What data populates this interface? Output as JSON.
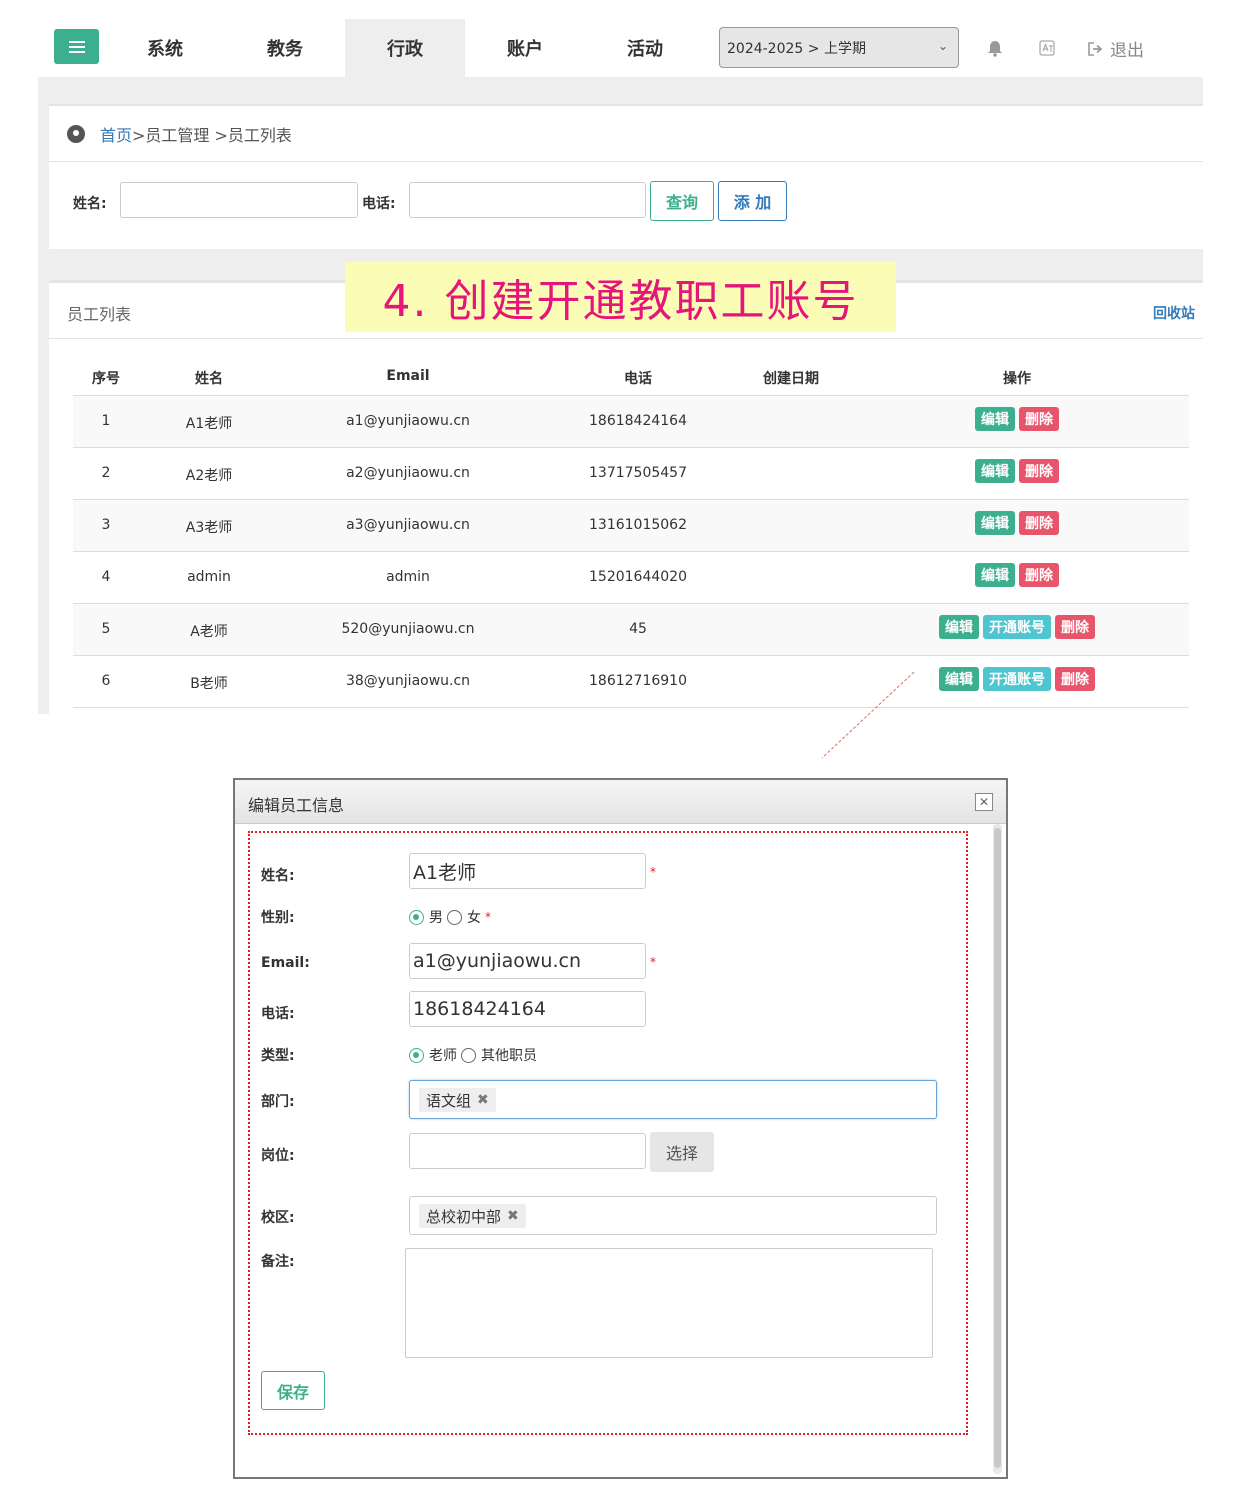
{
  "nav": {
    "tabs": [
      {
        "label": "系统",
        "active": false
      },
      {
        "label": "教务",
        "active": false
      },
      {
        "label": "行政",
        "active": true
      },
      {
        "label": "账户",
        "active": false
      },
      {
        "label": "活动",
        "active": false
      }
    ],
    "term_select": "2024-2025 > 上学期",
    "logout_label": "退出",
    "icons": [
      "menu-icon",
      "bell-icon",
      "translate-icon",
      "logout-icon"
    ],
    "accent_color": "#3cb08e"
  },
  "breadcrumb": {
    "home": "首页",
    "rest": ">员工管理 >员工列表"
  },
  "filters": {
    "name_label": "姓名:",
    "phone_label": "电话:",
    "query_label": "查询",
    "add_label": "添 加"
  },
  "list": {
    "title": "员工列表",
    "recycle_label": "回收站",
    "columns": [
      "序号",
      "姓名",
      "Email",
      "电话",
      "创建日期",
      "操作"
    ],
    "rows": [
      {
        "no": "1",
        "name": "A1老师",
        "email": "a1@yunjiaowu.cn",
        "phone": "18618424164",
        "created": "",
        "actions": [
          "编辑",
          "删除"
        ]
      },
      {
        "no": "2",
        "name": "A2老师",
        "email": "a2@yunjiaowu.cn",
        "phone": "13717505457",
        "created": "",
        "actions": [
          "编辑",
          "删除"
        ]
      },
      {
        "no": "3",
        "name": "A3老师",
        "email": "a3@yunjiaowu.cn",
        "phone": "13161015062",
        "created": "",
        "actions": [
          "编辑",
          "删除"
        ]
      },
      {
        "no": "4",
        "name": "admin",
        "email": "admin",
        "phone": "15201644020",
        "created": "",
        "actions": [
          "编辑",
          "删除"
        ]
      },
      {
        "no": "5",
        "name": "A老师",
        "email": "520@yunjiaowu.cn",
        "phone": "45",
        "created": "",
        "actions": [
          "编辑",
          "开通账号",
          "删除"
        ]
      },
      {
        "no": "6",
        "name": "B老师",
        "email": "38@yunjiaowu.cn",
        "phone": "18612716910",
        "created": "",
        "actions": [
          "编辑",
          "开通账号",
          "删除"
        ]
      }
    ]
  },
  "annotation": {
    "text": "4. 创建开通教职工账号",
    "bg_color": "#fbfcb6",
    "text_color": "#e5157a"
  },
  "dialog": {
    "title": "编辑员工信息",
    "fields": {
      "name_label": "姓名:",
      "name_value": "A1老师",
      "gender_label": "性别:",
      "gender_options": [
        "男",
        "女"
      ],
      "gender_selected": "男",
      "email_label": "Email:",
      "email_value": "a1@yunjiaowu.cn",
      "phone_label": "电话:",
      "phone_value": "18618424164",
      "type_label": "类型:",
      "type_options": [
        "老师",
        "其他职员"
      ],
      "type_selected": "老师",
      "dept_label": "部门:",
      "dept_tag": "语文组",
      "post_label": "岗位:",
      "post_value": "",
      "choose_label": "选择",
      "campus_label": "校区:",
      "campus_tag": "总校初中部",
      "remark_label": "备注:",
      "remark_value": "",
      "required_mark": "*"
    },
    "save_label": "保存"
  }
}
